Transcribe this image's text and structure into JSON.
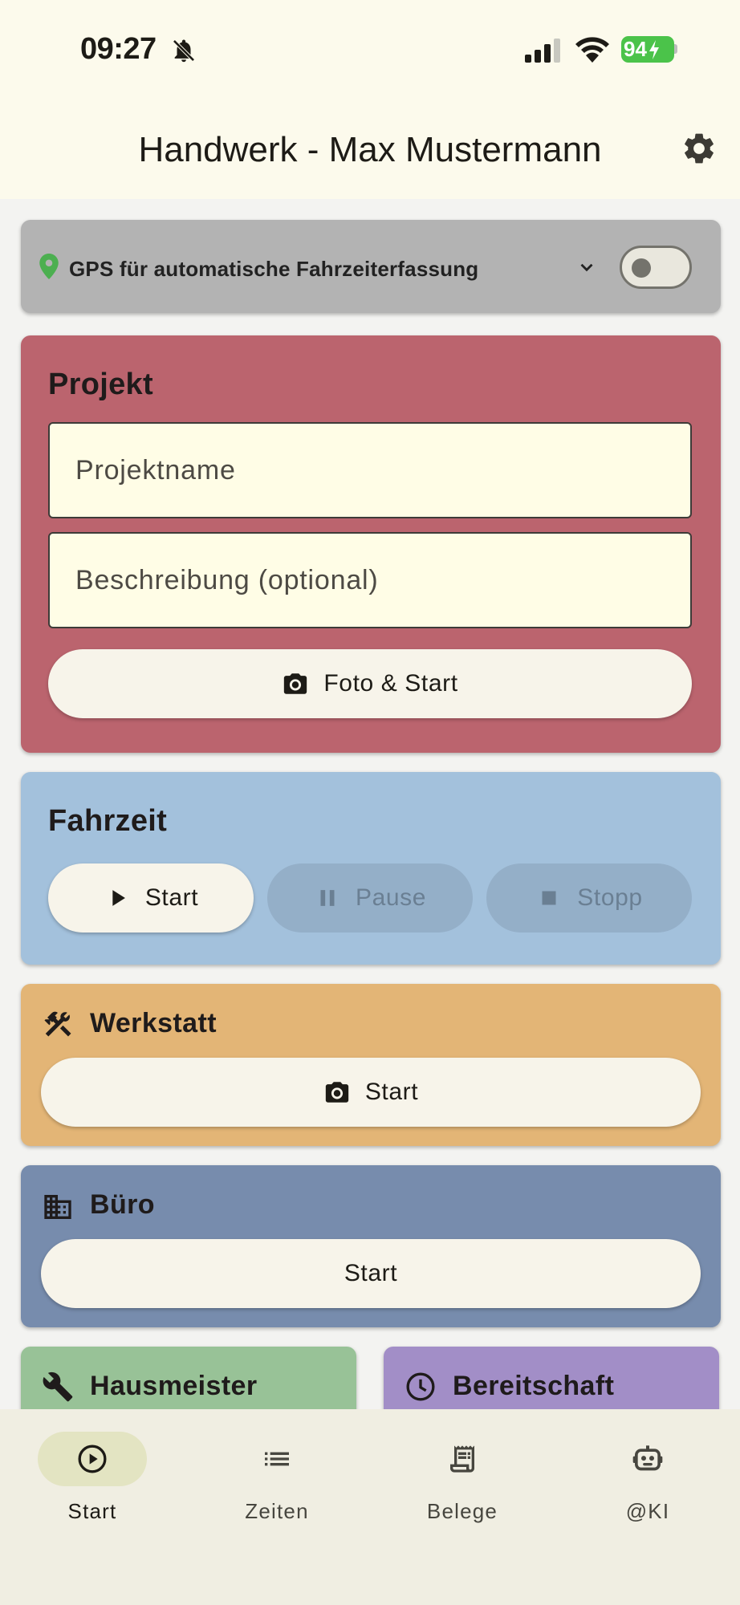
{
  "status_bar": {
    "time": "09:27",
    "battery": "94"
  },
  "app_bar": {
    "title": "Handwerk - Max Mustermann"
  },
  "gps": {
    "label": "GPS für automatische Fahrzeiterfassung",
    "enabled": false
  },
  "projekt": {
    "title": "Projekt",
    "name_placeholder": "Projektname",
    "description_placeholder": "Beschreibung (optional)",
    "photo_start_label": "Foto & Start"
  },
  "fahrzeit": {
    "title": "Fahrzeit",
    "start_label": "Start",
    "pause_label": "Pause",
    "stop_label": "Stopp"
  },
  "werkstatt": {
    "title": "Werkstatt",
    "start_label": "Start"
  },
  "buero": {
    "title": "Büro",
    "start_label": "Start"
  },
  "hausmeister": {
    "title": "Hausmeister"
  },
  "bereitschaft": {
    "title": "Bereitschaft"
  },
  "nav": {
    "items": [
      {
        "label": "Start",
        "icon": "play-circle-icon",
        "active": true
      },
      {
        "label": "Zeiten",
        "icon": "list-icon",
        "active": false
      },
      {
        "label": "Belege",
        "icon": "receipt-icon",
        "active": false
      },
      {
        "label": "@KI",
        "icon": "robot-icon",
        "active": false
      }
    ]
  },
  "colors": {
    "projekt": "#bb646e",
    "fahrzeit": "#a3c1dc",
    "werkstatt": "#e3b576",
    "buero": "#778cad",
    "hausmeister": "#98c297",
    "bereitschaft": "#a28ec7",
    "gps_pin": "#4caf50",
    "battery": "#4bc34a"
  }
}
